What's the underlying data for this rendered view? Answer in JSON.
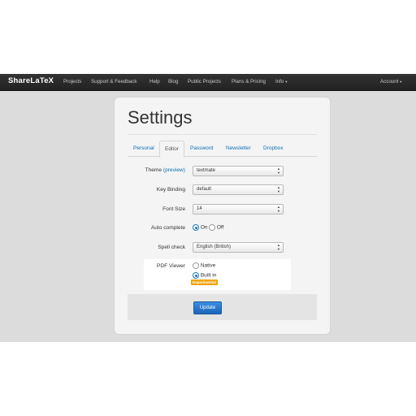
{
  "nav": {
    "brand": "ShareLaTeX",
    "items": [
      "Projects",
      "Support & Feedback",
      "Help",
      "Blog",
      "Public Projects",
      "Plans & Pricing",
      "Info"
    ],
    "account": "Account"
  },
  "settings": {
    "title": "Settings",
    "tabs": [
      "Personal",
      "Editor",
      "Password",
      "Newsletter",
      "Dropbox"
    ],
    "active_tab": "Editor",
    "theme": {
      "label": "Theme",
      "preview_link": "(preview)",
      "value": "textmate"
    },
    "key_binding": {
      "label": "Key Binding",
      "value": "default"
    },
    "font_size": {
      "label": "Font Size",
      "value": "14"
    },
    "auto_complete": {
      "label": "Auto complete",
      "options": [
        "On",
        "Off"
      ],
      "selected": "On"
    },
    "spell_check": {
      "label": "Spell check",
      "value": "English (British)"
    },
    "pdf_viewer": {
      "label": "PDF Viewer",
      "options": [
        "Native",
        "Built in"
      ],
      "selected": "Built in",
      "badge": "Experimental"
    },
    "update_button": "Update"
  },
  "colors": {
    "accent": "#1a75c7",
    "link": "#0a6fb5",
    "badge": "#f0a30a",
    "navbar": "#2a2a2a"
  }
}
